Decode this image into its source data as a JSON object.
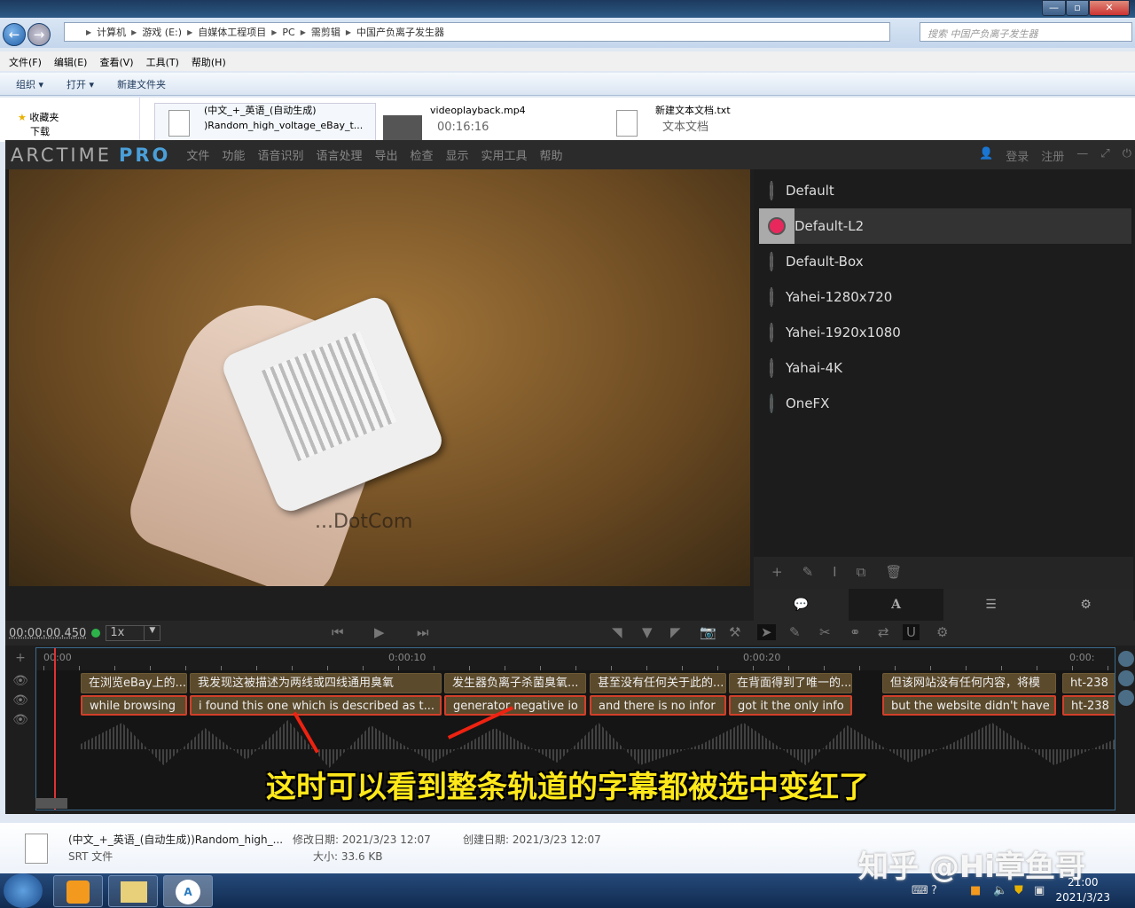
{
  "explorer": {
    "window_buttons": [
      "—",
      "▫",
      "✕"
    ],
    "breadcrumb": [
      "计算机",
      "游戏 (E:)",
      "自媒体工程项目",
      "PC",
      "需剪辑",
      "中国产负离子发生器"
    ],
    "search_placeholder": "搜索 中国产负离子发生器",
    "menu": [
      "文件(F)",
      "编辑(E)",
      "查看(V)",
      "工具(T)",
      "帮助(H)"
    ],
    "toolbar": {
      "organize": "组织 ▾",
      "open": "打开 ▾",
      "new_folder": "新建文件夹"
    },
    "nav": {
      "favorites": "收藏夹",
      "downloads": "下载"
    },
    "files": [
      {
        "name": "(中文_+_英语_(自动生成)",
        "name2": ")Random_high_voltage_eBay_t..."
      },
      {
        "name": "videoplayback.mp4",
        "sub": "00:16:16"
      },
      {
        "name": "新建文本文档.txt",
        "sub": "文本文档"
      }
    ],
    "details": {
      "name": "(中文_+_英语_(自动生成))Random_high_...",
      "type": "SRT 文件",
      "modified": "修改日期: 2021/3/23 12:07",
      "created": "创建日期: 2021/3/23 12:07",
      "size": "大小: 33.6 KB"
    }
  },
  "arctime": {
    "logo": "ARCTIME",
    "logo_pro": "PRO",
    "menu": [
      "文件",
      "功能",
      "语音识别",
      "语言处理",
      "导出",
      "检查",
      "显示",
      "实用工具",
      "帮助"
    ],
    "account": {
      "login": "登录",
      "register": "注册"
    },
    "video_watermark": "...DotCom",
    "styles": [
      {
        "name": "Default",
        "color": "#ffffff"
      },
      {
        "name": "Default-L2",
        "color": "#e8285c",
        "selected": true
      },
      {
        "name": "Default-Box",
        "color": "#ffffff"
      },
      {
        "name": "Yahei-1280x720",
        "color": "#ffffff"
      },
      {
        "name": "Yahei-1920x1080",
        "color": "#ffffff"
      },
      {
        "name": "Yahai-4K",
        "color": "#ffffff"
      },
      {
        "name": "OneFX",
        "color": "#5fd8f0"
      }
    ],
    "timecode": "00:00:00.450",
    "speed": "1x",
    "ruler": [
      "00:00",
      "0:00:10",
      "0:00:20",
      "0:00:"
    ],
    "track_cn": [
      "在浏览eBay上的...",
      "我发现这被描述为两线或四线通用臭氧",
      "发生器负离子杀菌臭氧...",
      "甚至没有任何关于此的...",
      "在背面得到了唯一的...",
      "但该网站没有任何内容，将模",
      "ht-238"
    ],
    "track_en": [
      "while browsing",
      "i found this one which is described as t...",
      "generator negative io",
      "and there is no infor",
      "got it the only info",
      "but the website didn't have",
      "ht-238"
    ]
  },
  "caption": "这时可以看到整条轨道的字幕都被选中变红了",
  "watermark": "知乎 @Hi章鱼哥",
  "taskbar": {
    "time": "21:00",
    "date": "2021/3/23"
  },
  "colors": {
    "selected_border": "#d2402a",
    "caption": "#ffe81a",
    "accent": "#4a9fd8"
  }
}
